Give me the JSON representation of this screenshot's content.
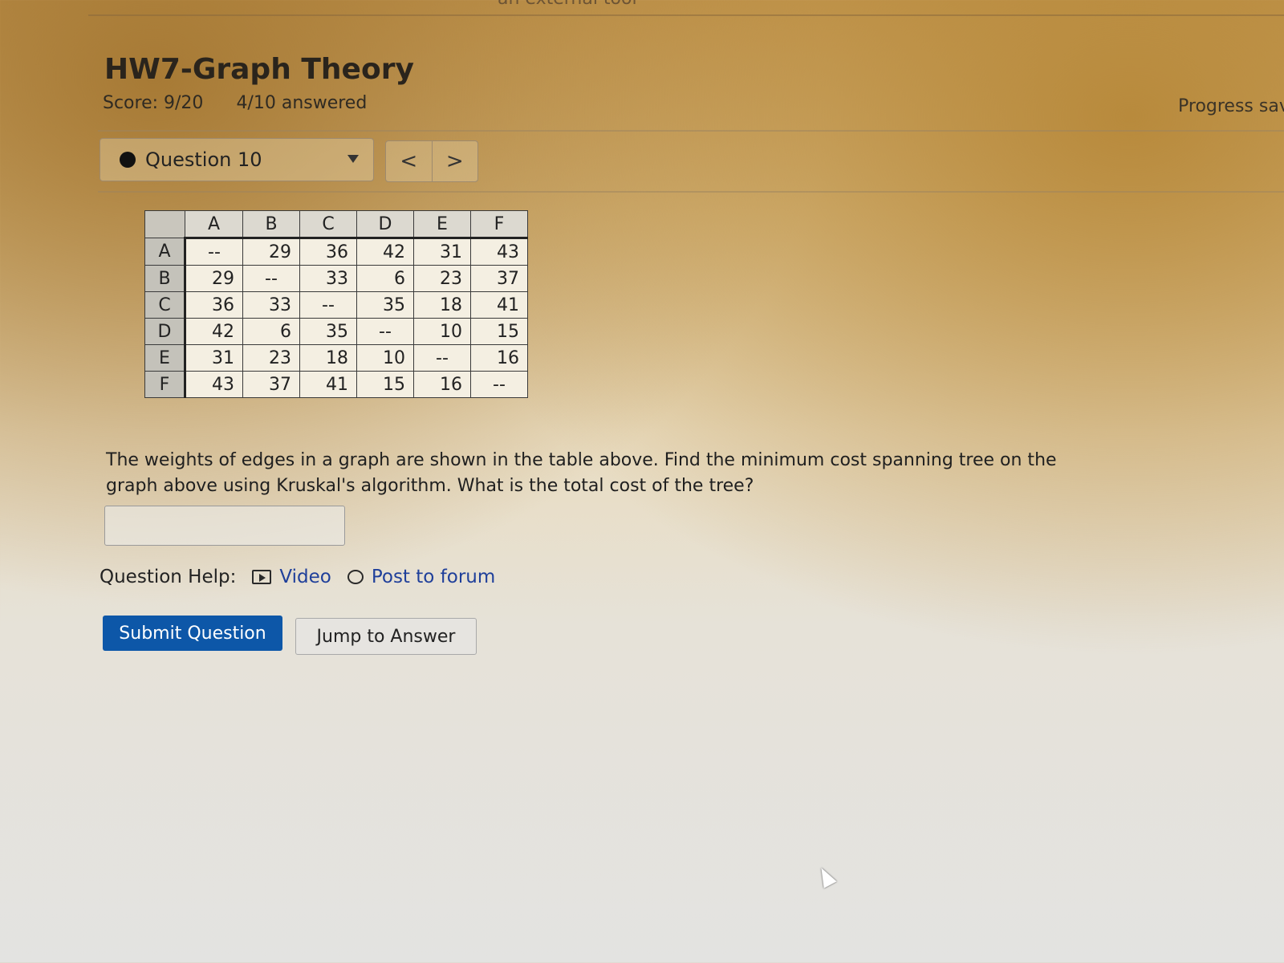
{
  "header": {
    "external_caption": "an external tool",
    "title": "HW7-Graph Theory",
    "score": "Score: 9/20",
    "answered": "4/10 answered",
    "progress": "Progress save"
  },
  "question_nav": {
    "selected": "Question 10",
    "prev_label": "<",
    "next_label": ">"
  },
  "matrix": {
    "headers": [
      "A",
      "B",
      "C",
      "D",
      "E",
      "F"
    ],
    "rows": [
      {
        "label": "A",
        "cells": [
          "--",
          "29",
          "36",
          "42",
          "31",
          "43"
        ]
      },
      {
        "label": "B",
        "cells": [
          "29",
          "--",
          "33",
          "6",
          "23",
          "37"
        ]
      },
      {
        "label": "C",
        "cells": [
          "36",
          "33",
          "--",
          "35",
          "18",
          "41"
        ]
      },
      {
        "label": "D",
        "cells": [
          "42",
          "6",
          "35",
          "--",
          "10",
          "15"
        ]
      },
      {
        "label": "E",
        "cells": [
          "31",
          "23",
          "18",
          "10",
          "--",
          "16"
        ]
      },
      {
        "label": "F",
        "cells": [
          "43",
          "37",
          "41",
          "15",
          "16",
          "--"
        ]
      }
    ]
  },
  "question": {
    "prompt": "The weights of edges in a graph are shown in the table above. Find the minimum cost spanning tree on the graph above using Kruskal's algorithm. What is the total cost of the tree?",
    "answer_value": ""
  },
  "help": {
    "label": "Question Help:",
    "video": "Video",
    "forum": "Post to forum"
  },
  "actions": {
    "submit": "Submit Question",
    "jump": "Jump to Answer"
  }
}
